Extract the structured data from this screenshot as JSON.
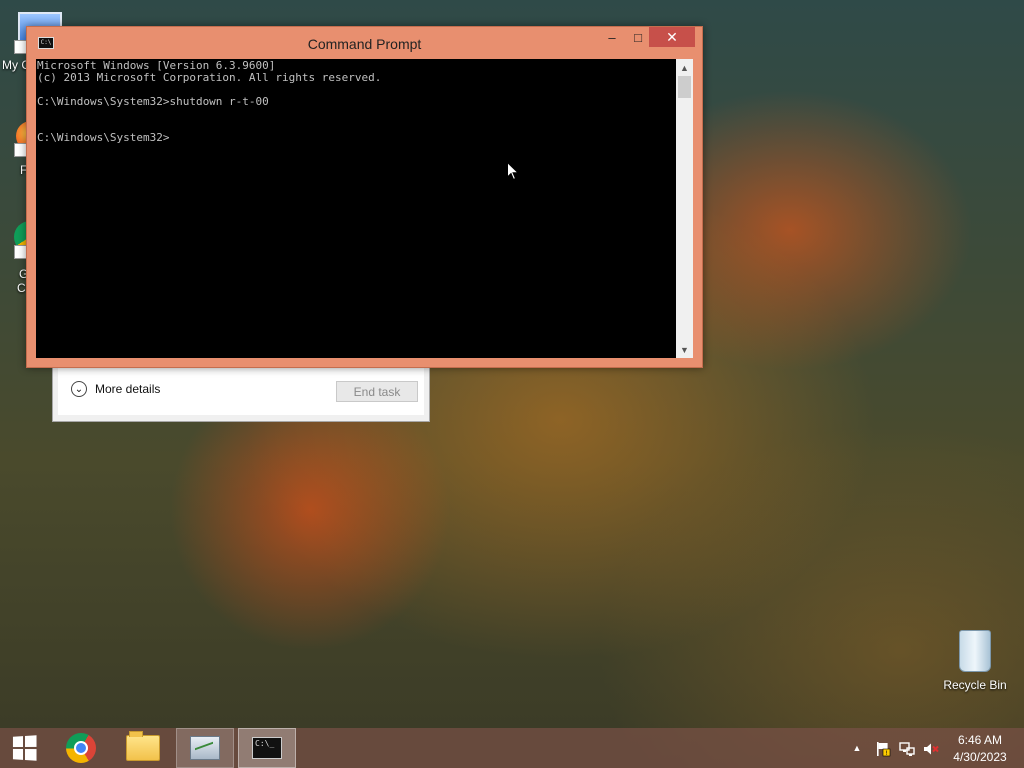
{
  "desktop": {
    "icons": [
      {
        "label": "My C"
      },
      {
        "label": "F"
      },
      {
        "label": "G",
        "label2": "C"
      }
    ],
    "recycle_bin": {
      "label": "Recycle Bin",
      "icon": "recycle-bin-icon"
    }
  },
  "task_manager": {
    "more_details": "More details",
    "end_task": "End task"
  },
  "cmd": {
    "title": "Command Prompt",
    "lines": [
      "Microsoft Windows [Version 6.3.9600]",
      "(c) 2013 Microsoft Corporation. All rights reserved.",
      "",
      "C:\\Windows\\System32>shutdown r-t-00",
      "",
      "",
      "C:\\Windows\\System32>"
    ],
    "controls": {
      "minimize": "–",
      "maximize": "□",
      "close": "✕"
    }
  },
  "taskbar": {
    "apps": [
      {
        "name": "start",
        "icon": "windows-logo-icon"
      },
      {
        "name": "chrome",
        "icon": "chrome-icon"
      },
      {
        "name": "file-explorer",
        "icon": "folder-icon"
      },
      {
        "name": "task-manager",
        "icon": "performance-monitor-icon"
      },
      {
        "name": "command-prompt",
        "icon": "cmd-icon"
      }
    ],
    "tray": {
      "icons": [
        "chevron-up-icon",
        "flag-icon",
        "network-icon",
        "volume-muted-icon"
      ],
      "time": "6:46 AM",
      "date": "4/30/2023"
    }
  },
  "colors": {
    "cmd_frame": "#e88f6f",
    "close_button": "#c7504a",
    "console_bg": "#000000",
    "console_text": "#c0c0c0"
  }
}
